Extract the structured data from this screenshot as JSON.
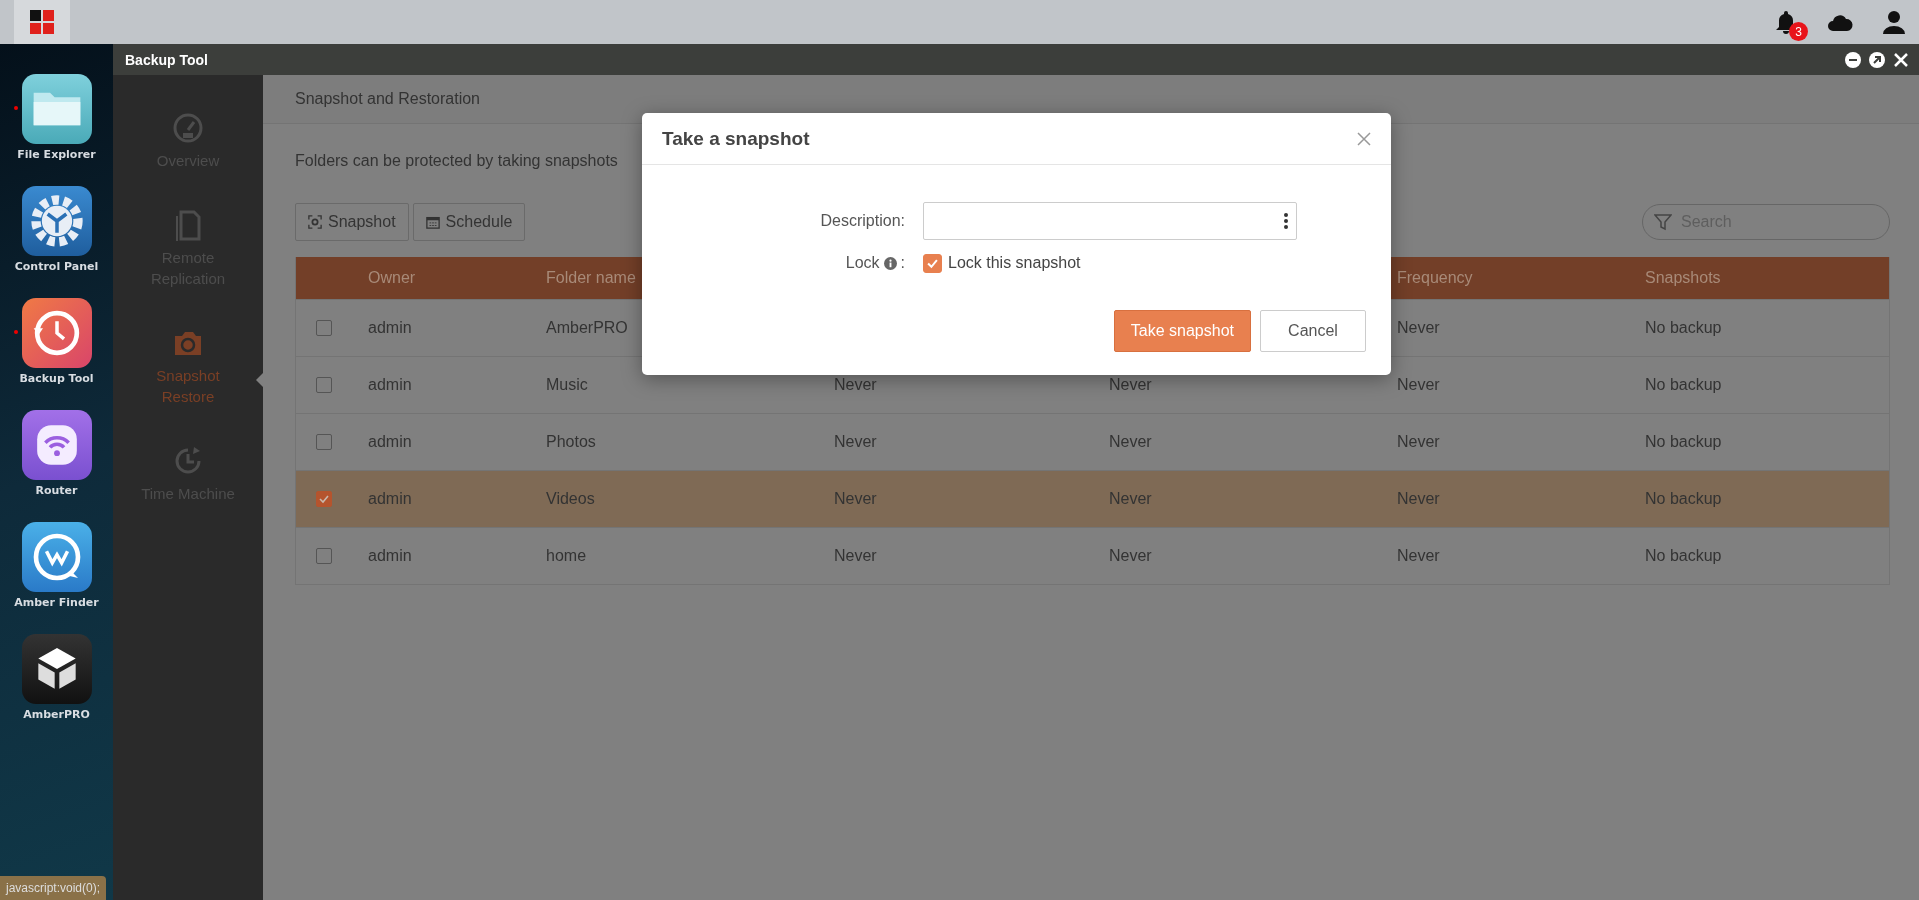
{
  "topbar": {
    "notification_count": "3"
  },
  "dock": {
    "apps": [
      {
        "label": "File Explorer",
        "kind": "folder",
        "running": true
      },
      {
        "label": "Control Panel",
        "kind": "gear",
        "running": false
      },
      {
        "label": "Backup Tool",
        "kind": "clock",
        "running": true
      },
      {
        "label": "Router",
        "kind": "wifi",
        "running": false
      },
      {
        "label": "Amber Finder",
        "kind": "finder",
        "running": false
      },
      {
        "label": "AmberPRO",
        "kind": "cube",
        "running": false
      }
    ]
  },
  "window": {
    "title": "Backup Tool"
  },
  "sidebar": {
    "items": [
      {
        "label": "Overview",
        "kind": "gauge",
        "selected": false
      },
      {
        "label": "Remote Replication",
        "kind": "copy",
        "selected": false
      },
      {
        "label": "Snapshot Restore",
        "kind": "camera",
        "selected": true
      },
      {
        "label": "Time Machine",
        "kind": "history",
        "selected": false
      }
    ]
  },
  "content": {
    "heading": "Snapshot and Restoration",
    "description": "Folders can be protected by taking snapshots",
    "toolbar": [
      {
        "label": "Snapshot",
        "kind": "snapshot"
      },
      {
        "label": "Schedule",
        "kind": "calendar"
      }
    ],
    "search": {
      "placeholder": "Search"
    },
    "table": {
      "columns": [
        {
          "label": "Owner"
        },
        {
          "label": "Folder name"
        },
        {},
        {},
        {
          "label": "Frequency"
        },
        {
          "label": "Snapshots"
        }
      ],
      "rows": [
        {
          "selected": false,
          "cells": [
            "admin",
            "AmberPRO",
            null,
            null,
            "Never",
            "No backup"
          ]
        },
        {
          "selected": false,
          "cells": [
            "admin",
            "Music",
            "Never",
            "Never",
            "Never",
            "No backup"
          ]
        },
        {
          "selected": false,
          "cells": [
            "admin",
            "Photos",
            "Never",
            "Never",
            "Never",
            "No backup"
          ]
        },
        {
          "selected": true,
          "cells": [
            "admin",
            "Videos",
            "Never",
            "Never",
            "Never",
            "No backup"
          ]
        },
        {
          "selected": false,
          "cells": [
            "admin",
            "home",
            "Never",
            "Never",
            "Never",
            "No backup"
          ]
        }
      ]
    }
  },
  "dialog": {
    "title": "Take a snapshot",
    "fields": [
      {
        "kind": "text",
        "label": "Description:"
      },
      {
        "kind": "checkbox",
        "label": "Lock",
        "label_suffix": ":",
        "option": "Lock this snapshot",
        "checked": true
      }
    ],
    "buttons": [
      {
        "label": "Take snapshot",
        "primary": true
      },
      {
        "label": "Cancel",
        "primary": false
      }
    ]
  },
  "status_tip": "javascript:void(0);"
}
